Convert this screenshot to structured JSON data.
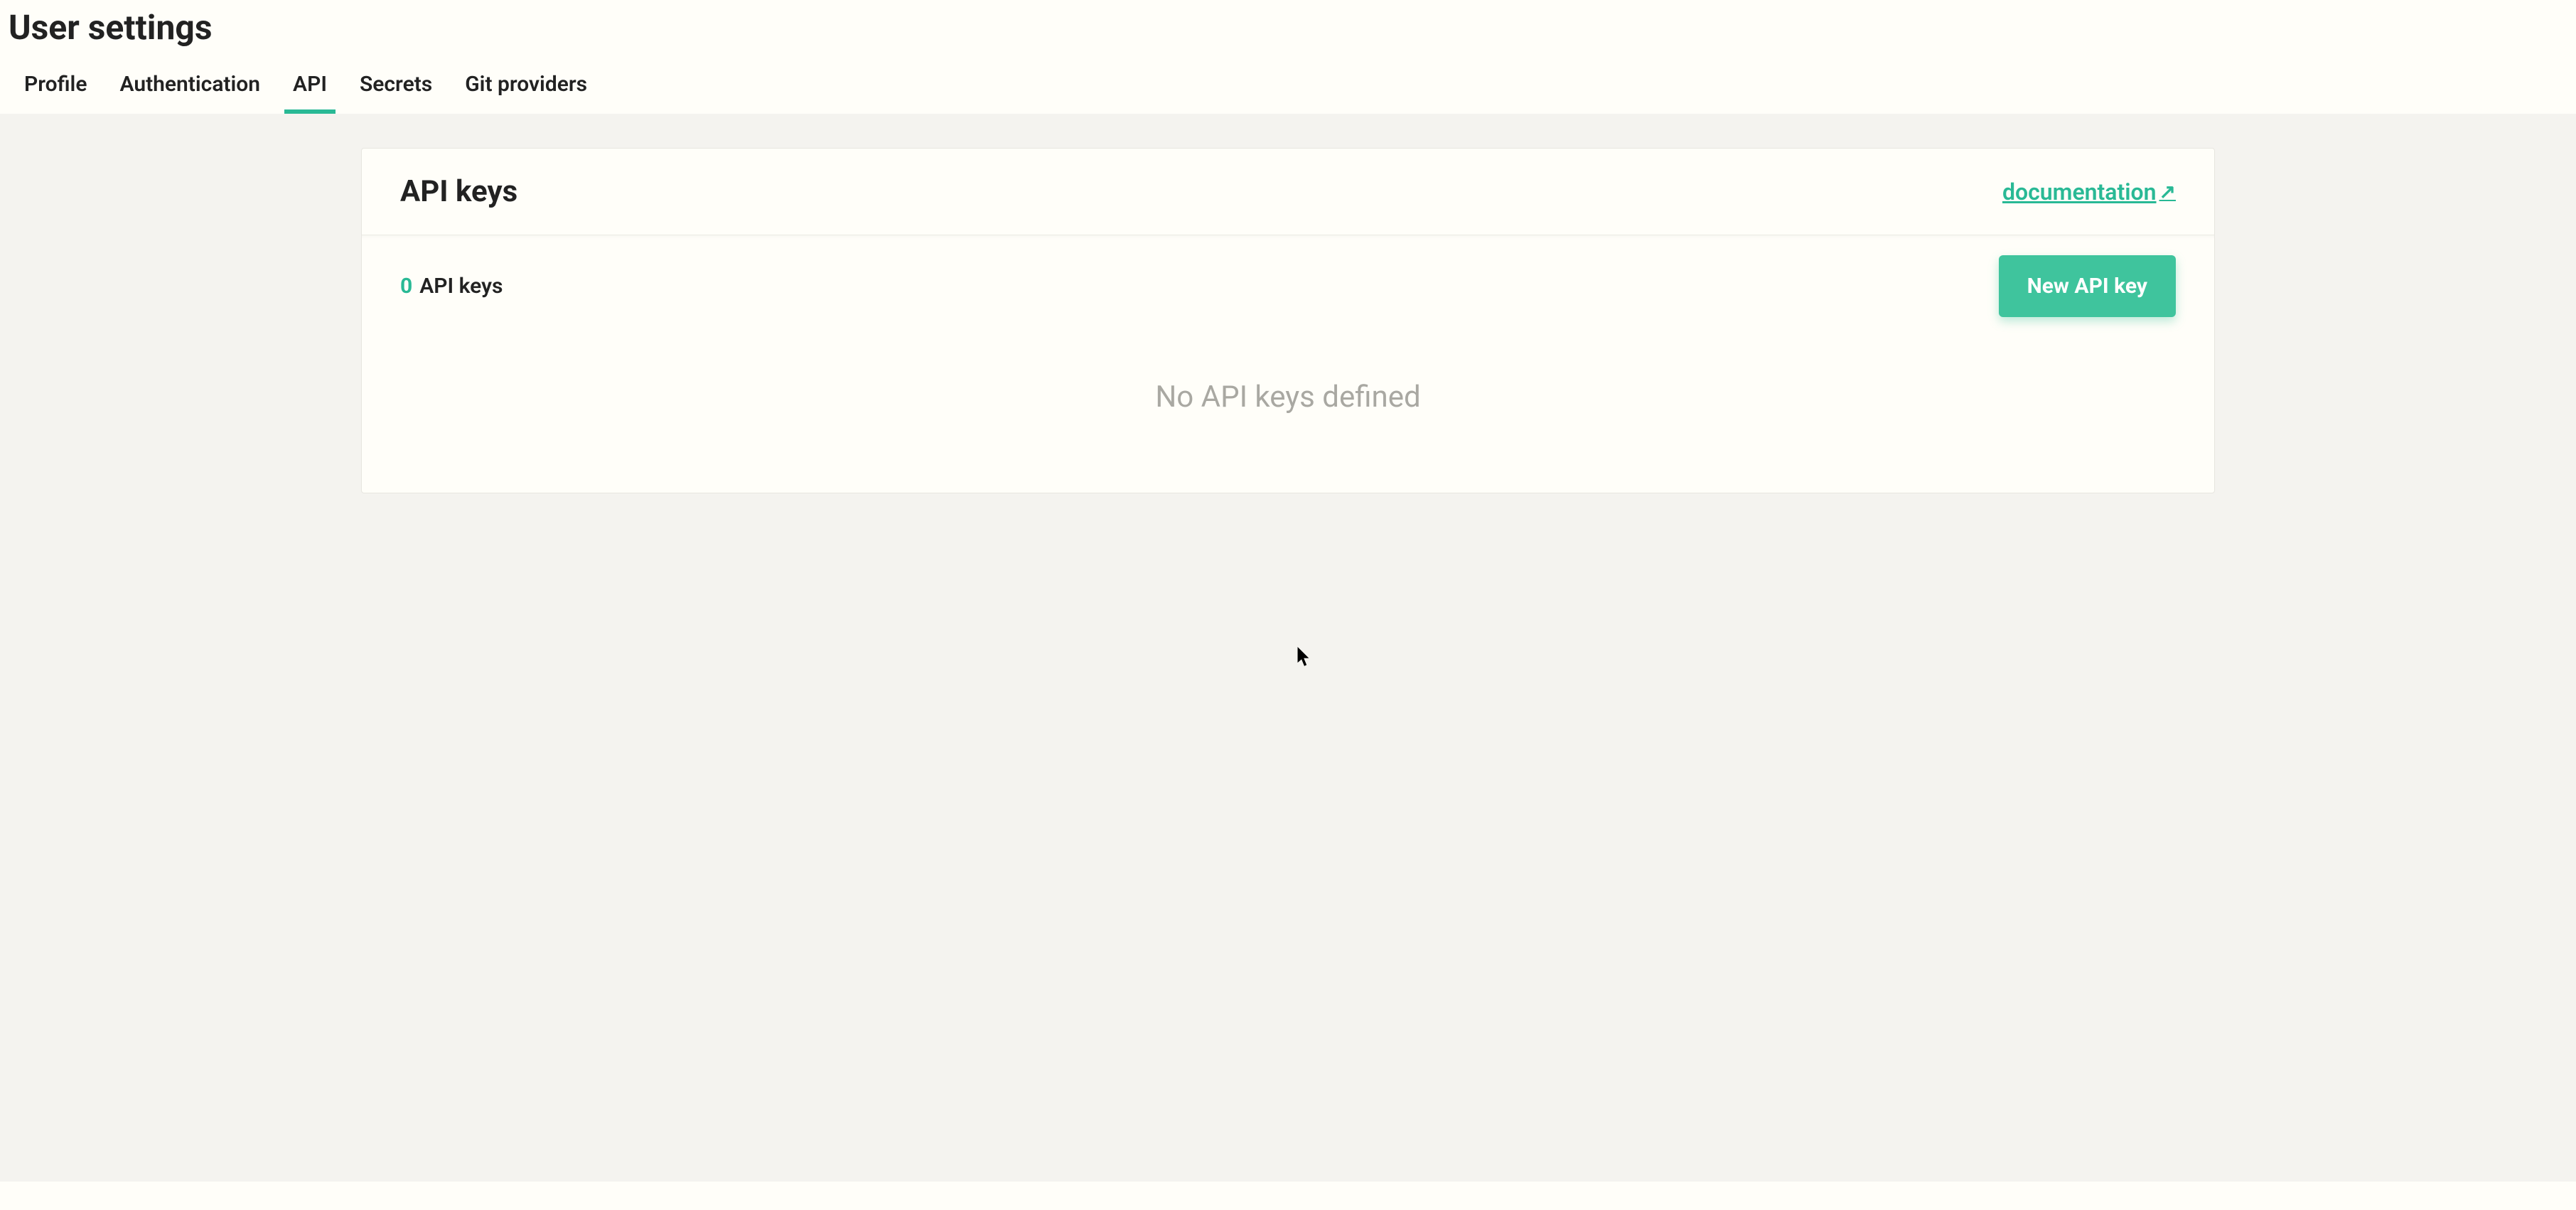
{
  "header": {
    "title": "User settings",
    "tabs": [
      {
        "label": "Profile",
        "active": false
      },
      {
        "label": "Authentication",
        "active": false
      },
      {
        "label": "API",
        "active": true
      },
      {
        "label": "Secrets",
        "active": false
      },
      {
        "label": "Git providers",
        "active": false
      }
    ]
  },
  "card": {
    "title": "API keys",
    "documentation_label": "documentation",
    "count": "0",
    "count_label": "API keys",
    "new_button": "New API key",
    "empty_message": "No API keys defined"
  }
}
